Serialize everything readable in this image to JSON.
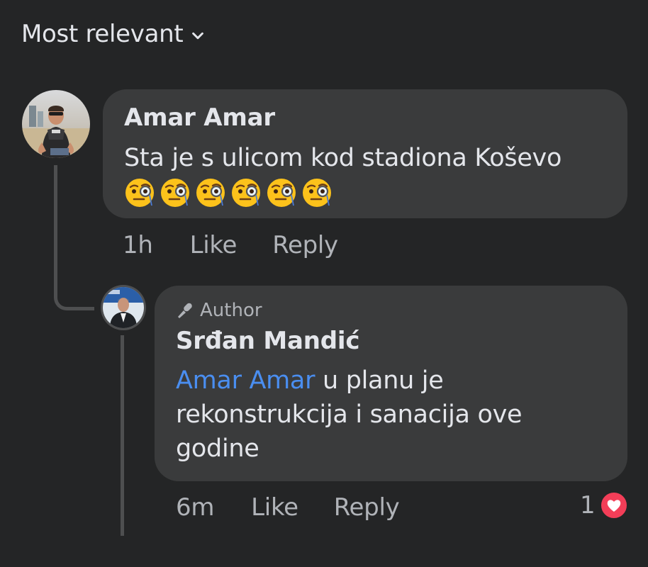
{
  "sort": {
    "label": "Most relevant"
  },
  "comments": [
    {
      "author": "Amar Amar",
      "text": "Sta je s ulicom kod stadiona Koševo",
      "emojis": [
        "face-with-monocle",
        "face-with-monocle",
        "face-with-monocle",
        "face-with-monocle",
        "face-with-monocle",
        "face-with-monocle"
      ],
      "time": "1h",
      "like_label": "Like",
      "reply_label": "Reply"
    }
  ],
  "reply": {
    "badge": "Author",
    "badge_icon": "microphone-icon",
    "author": "Srđan Mandić",
    "mention": "Amar Amar",
    "text": " u planu je rekonstrukcija i sanacija ove godine",
    "time": "6m",
    "like_label": "Like",
    "reply_label": "Reply",
    "reaction_count": "1",
    "reaction_icon": "heart-icon"
  },
  "colors": {
    "background": "#242526",
    "bubble": "#3a3b3c",
    "mention": "#4a8ef0",
    "heart": "#f33e58"
  }
}
